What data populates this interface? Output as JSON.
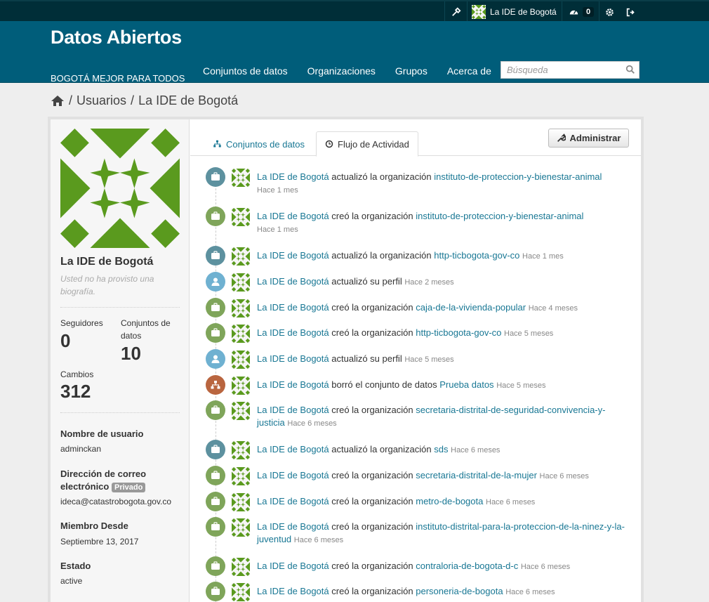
{
  "account": {
    "user_name": "La IDE de Bogotá",
    "dashboard_count": "0"
  },
  "site": {
    "title": "Datos Abiertos",
    "description": "BOGOTÁ MEJOR PARA TODOS"
  },
  "nav": {
    "items": [
      "Conjuntos de datos",
      "Organizaciones",
      "Grupos",
      "Acerca de"
    ]
  },
  "search": {
    "placeholder": "Búsqueda"
  },
  "breadcrumb": {
    "users": "Usuarios",
    "current": "La IDE de Bogotá"
  },
  "profile": {
    "name": "La IDE de Bogotá",
    "bio": "Usted no ha provisto una biografía.",
    "followers_label": "Seguidores",
    "followers": "0",
    "datasets_label": "Conjuntos de datos",
    "datasets": "10",
    "edits_label": "Cambios",
    "edits": "312",
    "username_label": "Nombre de usuario",
    "username": "adminckan",
    "email_label": "Dirección de correo electrónico",
    "email_badge": "Privado",
    "email": "ideca@catastrobogota.gov.co",
    "member_since_label": "Miembro Desde",
    "member_since": "Septiembre 13, 2017",
    "state_label": "Estado",
    "state": "active"
  },
  "tabs": {
    "datasets": "Conjuntos de datos",
    "activity": "Flujo de Actividad",
    "admin": "Administrar"
  },
  "colors": {
    "masthead": "#005d7a",
    "account_bar": "#002e38",
    "link": "#187794",
    "org_updated": "#5d919f",
    "org_created": "#7fa55a",
    "user_updated": "#6fb1d1",
    "dataset_deleted": "#b9653f",
    "avatar_green": "#5a9a1e"
  },
  "activities": [
    {
      "icon": "briefcase-icon",
      "kind": "org_updated",
      "actor": "La IDE de Bogotá",
      "verb": "actualizó la organización",
      "object": "instituto-de-proteccion-y-bienestar-animal",
      "date": "Hace 1 mes",
      "date_newline": true
    },
    {
      "icon": "briefcase-icon",
      "kind": "org_created",
      "actor": "La IDE de Bogotá",
      "verb": "creó la organización",
      "object": "instituto-de-proteccion-y-bienestar-animal",
      "date": "Hace 1 mes",
      "date_newline": true
    },
    {
      "icon": "briefcase-icon",
      "kind": "org_updated",
      "actor": "La IDE de Bogotá",
      "verb": "actualizó la organización",
      "object": "http-ticbogota-gov-co",
      "date": "Hace 1 mes"
    },
    {
      "icon": "user-icon",
      "kind": "user_updated",
      "actor": "La IDE de Bogotá",
      "verb": "actualizó su perfil",
      "object": "",
      "date": "Hace 2 meses"
    },
    {
      "icon": "briefcase-icon",
      "kind": "org_created",
      "actor": "La IDE de Bogotá",
      "verb": "creó la organización",
      "object": "caja-de-la-vivienda-popular",
      "date": "Hace 4 meses"
    },
    {
      "icon": "briefcase-icon",
      "kind": "org_created",
      "actor": "La IDE de Bogotá",
      "verb": "creó la organización",
      "object": "http-ticbogota-gov-co",
      "date": "Hace 5 meses"
    },
    {
      "icon": "user-icon",
      "kind": "user_updated",
      "actor": "La IDE de Bogotá",
      "verb": "actualizó su perfil",
      "object": "",
      "date": "Hace 5 meses"
    },
    {
      "icon": "sitemap-icon",
      "kind": "dataset_deleted",
      "actor": "La IDE de Bogotá",
      "verb": "borró el conjunto de datos",
      "object": "Prueba datos",
      "date": "Hace 5 meses"
    },
    {
      "icon": "briefcase-icon",
      "kind": "org_created",
      "actor": "La IDE de Bogotá",
      "verb": "creó la organización",
      "object": "secretaria-distrital-de-seguridad-convivencia-y-justicia",
      "date": "Hace 6 meses"
    },
    {
      "icon": "briefcase-icon",
      "kind": "org_updated",
      "actor": "La IDE de Bogotá",
      "verb": "actualizó la organización",
      "object": "sds",
      "date": "Hace 6 meses"
    },
    {
      "icon": "briefcase-icon",
      "kind": "org_created",
      "actor": "La IDE de Bogotá",
      "verb": "creó la organización",
      "object": "secretaria-distrital-de-la-mujer",
      "date": "Hace 6 meses"
    },
    {
      "icon": "briefcase-icon",
      "kind": "org_created",
      "actor": "La IDE de Bogotá",
      "verb": "creó la organización",
      "object": "metro-de-bogota",
      "date": "Hace 6 meses"
    },
    {
      "icon": "briefcase-icon",
      "kind": "org_created",
      "actor": "La IDE de Bogotá",
      "verb": "creó la organización",
      "object": "instituto-distrital-para-la-proteccion-de-la-ninez-y-la-juventud",
      "date": "Hace 6 meses"
    },
    {
      "icon": "briefcase-icon",
      "kind": "org_created",
      "actor": "La IDE de Bogotá",
      "verb": "creó la organización",
      "object": "contraloria-de-bogota-d-c",
      "date": "Hace 6 meses"
    },
    {
      "icon": "briefcase-icon",
      "kind": "org_created",
      "actor": "La IDE de Bogotá",
      "verb": "creó la organización",
      "object": "personeria-de-bogota",
      "date": "Hace 6 meses"
    }
  ]
}
